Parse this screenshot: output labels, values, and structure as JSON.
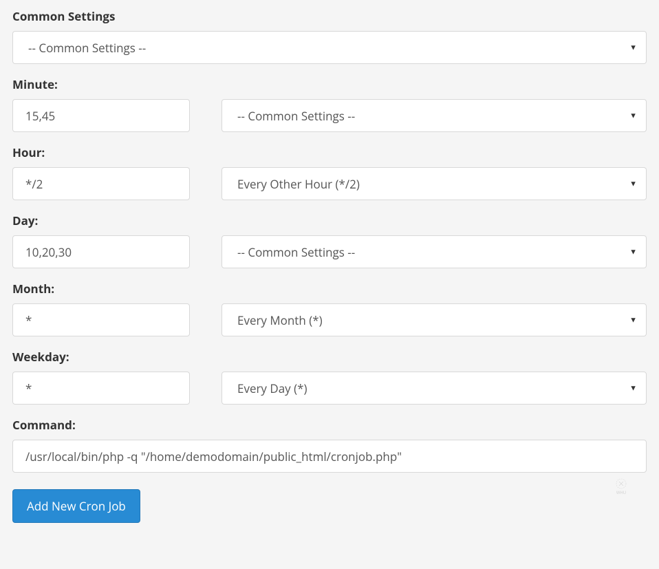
{
  "common_settings": {
    "label": "Common Settings",
    "selected": "-- Common Settings --"
  },
  "minute": {
    "label": "Minute:",
    "value": "15,45",
    "preset_selected": "-- Common Settings --"
  },
  "hour": {
    "label": "Hour:",
    "value": "*/2",
    "preset_selected": "Every Other Hour (*/2)"
  },
  "day": {
    "label": "Day:",
    "value": "10,20,30",
    "preset_selected": "-- Common Settings --"
  },
  "month": {
    "label": "Month:",
    "value": "*",
    "preset_selected": "Every Month (*)"
  },
  "weekday": {
    "label": "Weekday:",
    "value": "*",
    "preset_selected": "Every Day (*)"
  },
  "command": {
    "label": "Command:",
    "value": "/usr/local/bin/php -q \"/home/demodomain/public_html/cronjob.php\""
  },
  "submit_label": "Add New Cron Job",
  "footer_logo_text": "WHU"
}
